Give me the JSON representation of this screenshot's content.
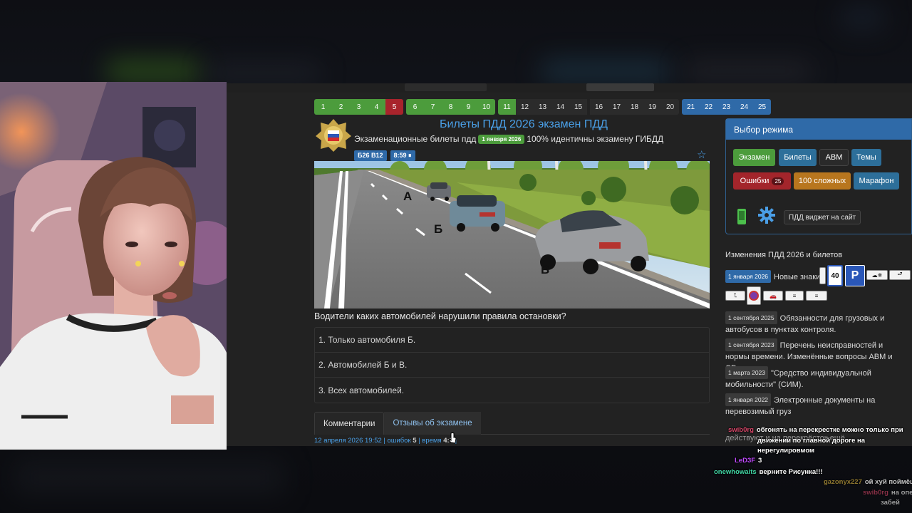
{
  "pager": {
    "tickets": [
      {
        "n": "1",
        "state": "g"
      },
      {
        "n": "2",
        "state": "g"
      },
      {
        "n": "3",
        "state": "g"
      },
      {
        "n": "4",
        "state": "g"
      },
      {
        "n": "5",
        "state": "r"
      },
      {
        "n": "6",
        "state": "g"
      },
      {
        "n": "7",
        "state": "g"
      },
      {
        "n": "8",
        "state": "g"
      },
      {
        "n": "9",
        "state": "g"
      },
      {
        "n": "10",
        "state": "g"
      },
      {
        "n": "11",
        "state": "g"
      },
      {
        "n": "12",
        "state": "d"
      },
      {
        "n": "13",
        "state": "d"
      },
      {
        "n": "14",
        "state": "d"
      },
      {
        "n": "15",
        "state": "d"
      },
      {
        "n": "16",
        "state": "d"
      },
      {
        "n": "17",
        "state": "d"
      },
      {
        "n": "18",
        "state": "d"
      },
      {
        "n": "19",
        "state": "d"
      },
      {
        "n": "20",
        "state": "d"
      },
      {
        "n": "21",
        "state": "b"
      },
      {
        "n": "22",
        "state": "b"
      },
      {
        "n": "23",
        "state": "b"
      },
      {
        "n": "24",
        "state": "b"
      },
      {
        "n": "25",
        "state": "b"
      }
    ]
  },
  "header": {
    "title": "Билеты ПДД 2026 экзамен ПДД",
    "subtitle_before": "Экзаменационные билеты пдд",
    "date_badge": "1 января 2026",
    "subtitle_after": "100% идентичны экзамену ГИБДД",
    "ticket_tag": "Б26 В12",
    "timer_tag": "8:59 ⏸"
  },
  "road_labels": {
    "a": "А",
    "b": "Б",
    "v": "В"
  },
  "question": {
    "text": "Водители каких автомобилей нарушили правила остановки?",
    "answers": [
      "1. Только автомобиля Б.",
      "2. Автомобилей Б и В.",
      "3. Всех автомобилей."
    ]
  },
  "tabs": {
    "comments": "Комментарии",
    "reviews": "Отзывы об экзамене"
  },
  "meta": {
    "date": "12 апреля 2026 19:52",
    "errors_label": "ошибок",
    "errors_value": "5",
    "time_label": "время",
    "time_value": "4:3"
  },
  "mode_panel": {
    "title": "Выбор режима",
    "exam": "Экзамен",
    "tickets": "Билеты",
    "abm": "ABM",
    "topics": "Темы",
    "errors": "Ошибки",
    "errors_count": "25",
    "hard": "100 сложных",
    "marathon": "Марафон",
    "widget": "ПДД виджет на сайт"
  },
  "changes": {
    "title": "Изменения ПДД 2026 и билетов",
    "items": [
      {
        "date": "1 января 2026",
        "text": "Новые знаки"
      },
      {
        "date": "1 сентября 2025",
        "text": "Обязанности для грузовых и автобусов в пунктах контроля."
      },
      {
        "date": "1 сентября 2023",
        "text": "Перечень неисправностей и нормы времени. Изменённые вопросы ABM и CD."
      },
      {
        "date": "1 марта 2023",
        "text": "\"Средство индивидуальной мобильности\" (СИМ)."
      },
      {
        "date": "1 января 2022",
        "text": "Электронные документы на перевозимый груз"
      },
      {
        "date": "",
        "text": "действуют и на перекрёсток ещё ..."
      }
    ],
    "sign_40": "40",
    "sign_p": "P"
  },
  "chat": [
    {
      "user": "swib0rg",
      "text": "обгонять на перекрестке можно только при"
    },
    {
      "user": "",
      "text": "движении по главной дороге на"
    },
    {
      "user": "",
      "text": "нерегулировмом"
    },
    {
      "user": "LeD3F",
      "text": "3"
    },
    {
      "user": "onewhowaits",
      "text": "верните Рисунка!!!"
    },
    {
      "user": "gazonyx227",
      "text": "ой хуй поймёшь"
    },
    {
      "user": "swib0rg",
      "text": "на опе"
    },
    {
      "user": "",
      "text": "забей"
    }
  ],
  "colors": {
    "green": "#4c9c3c",
    "red": "#a8242c",
    "blue": "#2f6aa8",
    "link": "#4aa0e8",
    "orange": "#b8761e",
    "dark_red": "#a3252b",
    "teal": "#2d6f9a"
  }
}
